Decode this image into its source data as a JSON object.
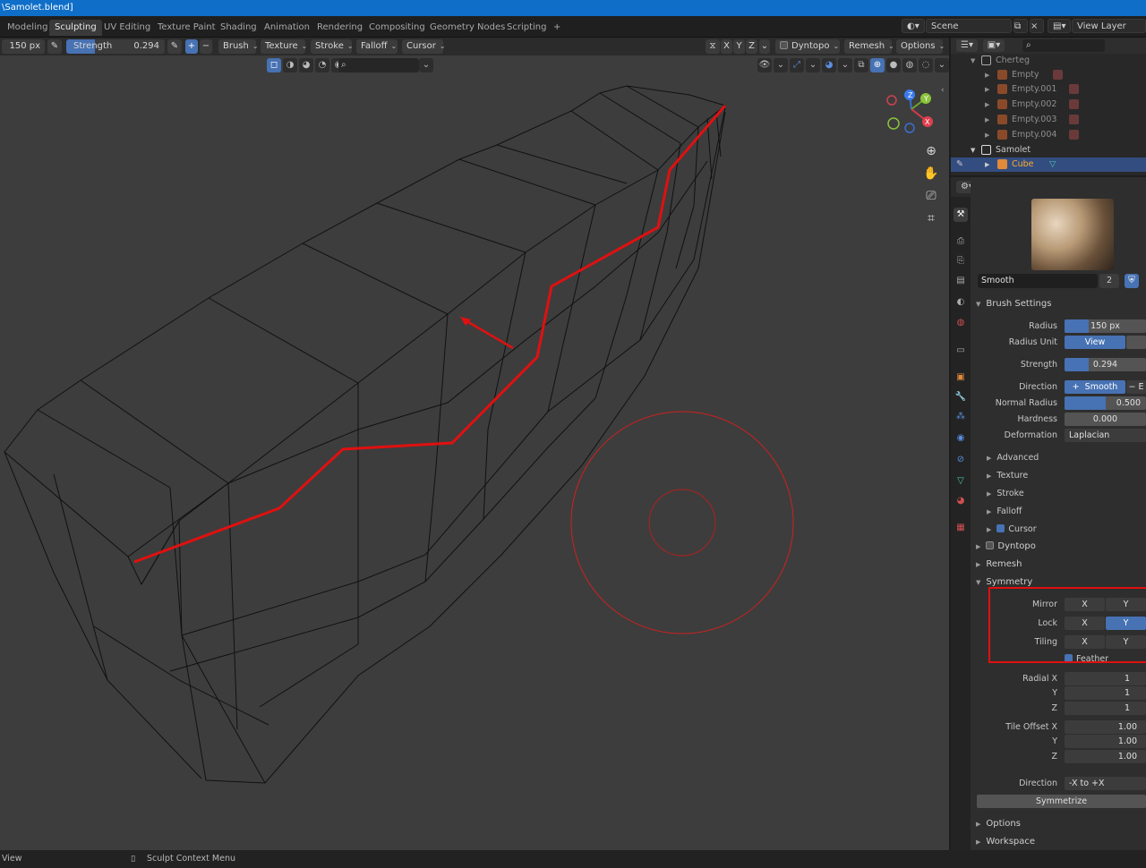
{
  "window": {
    "title": "\\Samolet.blend]"
  },
  "workspace_tabs": [
    {
      "label": "Modeling"
    },
    {
      "label": "Sculpting"
    },
    {
      "label": "UV Editing"
    },
    {
      "label": "Texture Paint"
    },
    {
      "label": "Shading"
    },
    {
      "label": "Animation"
    },
    {
      "label": "Rendering"
    },
    {
      "label": "Compositing"
    },
    {
      "label": "Geometry Nodes"
    },
    {
      "label": "Scripting"
    },
    {
      "label": "+"
    }
  ],
  "topbar_right": {
    "scene_label": "Scene",
    "view_layer_label": "View Layer"
  },
  "header": {
    "radius": "150 px",
    "strength_label": "Strength",
    "strength_value": "0.294",
    "strength_fraction": 0.294,
    "plus": "+",
    "minus": "−",
    "menus": [
      "Brush",
      "Texture",
      "Stroke",
      "Falloff",
      "Cursor"
    ],
    "axes": [
      "X",
      "Y",
      "Z"
    ],
    "dyntopo": "Dyntopo",
    "remesh": "Remesh",
    "options": "Options"
  },
  "outliner": {
    "rows": [
      {
        "label": "Cherteg"
      },
      {
        "label": "Empty"
      },
      {
        "label": "Empty.001"
      },
      {
        "label": "Empty.002"
      },
      {
        "label": "Empty.003"
      },
      {
        "label": "Empty.004"
      },
      {
        "label": "Samolet"
      },
      {
        "label": "Cube"
      }
    ]
  },
  "properties": {
    "brush_name": "Smooth",
    "brush_users": "2",
    "brush_settings_title": "Brush Settings",
    "radius_label": "Radius",
    "radius_value": "150 px",
    "radius_fraction": 0.5,
    "radius_unit_label": "Radius Unit",
    "radius_unit_value": "View",
    "strength_label": "Strength",
    "strength_value": "0.294",
    "strength_fraction": 0.294,
    "direction_label": "Direction",
    "direction_plus": "+",
    "direction_smooth": "Smooth",
    "direction_minus": "−",
    "direction_minus_label": "E",
    "normal_radius_label": "Normal Radius",
    "normal_radius_value": "0.500",
    "normal_radius_fraction": 0.5,
    "hardness_label": "Hardness",
    "hardness_value": "0.000",
    "deformation_label": "Deformation",
    "deformation_value": "Laplacian",
    "subpanels": [
      "Advanced",
      "Texture",
      "Stroke",
      "Falloff",
      "Cursor"
    ],
    "dyntopo": "Dyntopo",
    "remesh": "Remesh",
    "symmetry": "Symmetry",
    "mirror_label": "Mirror",
    "lock_label": "Lock",
    "tiling_label": "Tiling",
    "x": "X",
    "y": "Y",
    "feather_label": "Feather",
    "radial_x_label": "Radial X",
    "radial_y_label": "Y",
    "radial_z_label": "Z",
    "radial_x": "1",
    "radial_y": "1",
    "radial_z": "1",
    "tile_offset_x_label": "Tile Offset X",
    "tile_offset_y_label": "Y",
    "tile_offset_z_label": "Z",
    "tile_offset_x": "1.00",
    "tile_offset_y": "1.00",
    "tile_offset_z": "1.00",
    "sym_direction_label": "Direction",
    "sym_direction_value": "-X to +X",
    "symmetrize": "Symmetrize",
    "options": "Options",
    "workspace": "Workspace"
  },
  "statusbar": {
    "left": "View",
    "context_menu": "Sculpt Context Menu"
  },
  "colors": {
    "accent": "#4772b3",
    "annotation": "#e01010",
    "viewport_bg": "#3d3d3d",
    "selected_orange": "#ffaf29"
  },
  "icons": [
    "search-icon",
    "hand-icon",
    "camera-icon",
    "grid-icon",
    "zoom-icon",
    "gizmo-axes"
  ]
}
